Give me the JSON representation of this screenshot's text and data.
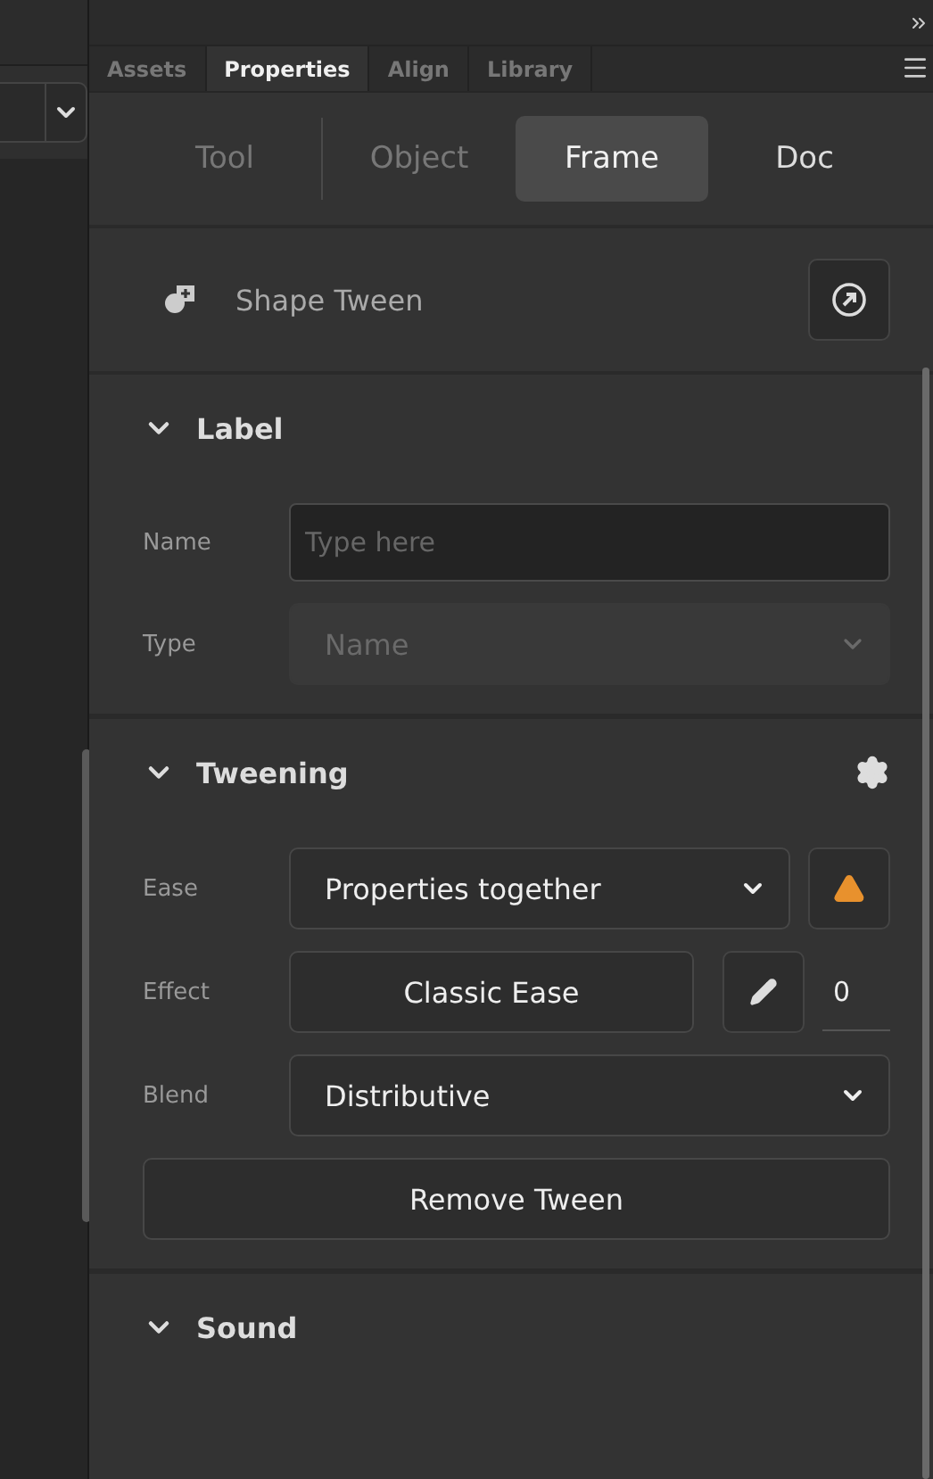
{
  "panel_tabs": [
    {
      "label": "Assets",
      "selected": false
    },
    {
      "label": "Properties",
      "selected": true
    },
    {
      "label": "Align",
      "selected": false
    },
    {
      "label": "Library",
      "selected": false
    }
  ],
  "segments": [
    {
      "label": "Tool",
      "selected": false
    },
    {
      "label": "Object",
      "selected": false
    },
    {
      "label": "Frame",
      "selected": true
    },
    {
      "label": "Doc",
      "selected": false
    }
  ],
  "tween_type": "Shape Tween",
  "label_section": {
    "title": "Label",
    "expanded": true,
    "name_label": "Name",
    "name_placeholder": "Type here",
    "type_label": "Type",
    "type_value": "Name",
    "type_disabled": true
  },
  "tweening_section": {
    "title": "Tweening",
    "expanded": true,
    "ease_label": "Ease",
    "ease_value": "Properties together",
    "effect_label": "Effect",
    "effect_value": "Classic Ease",
    "effect_amount": "0",
    "blend_label": "Blend",
    "blend_value": "Distributive",
    "remove_button": "Remove Tween"
  },
  "sound_section": {
    "title": "Sound",
    "expanded": true
  }
}
